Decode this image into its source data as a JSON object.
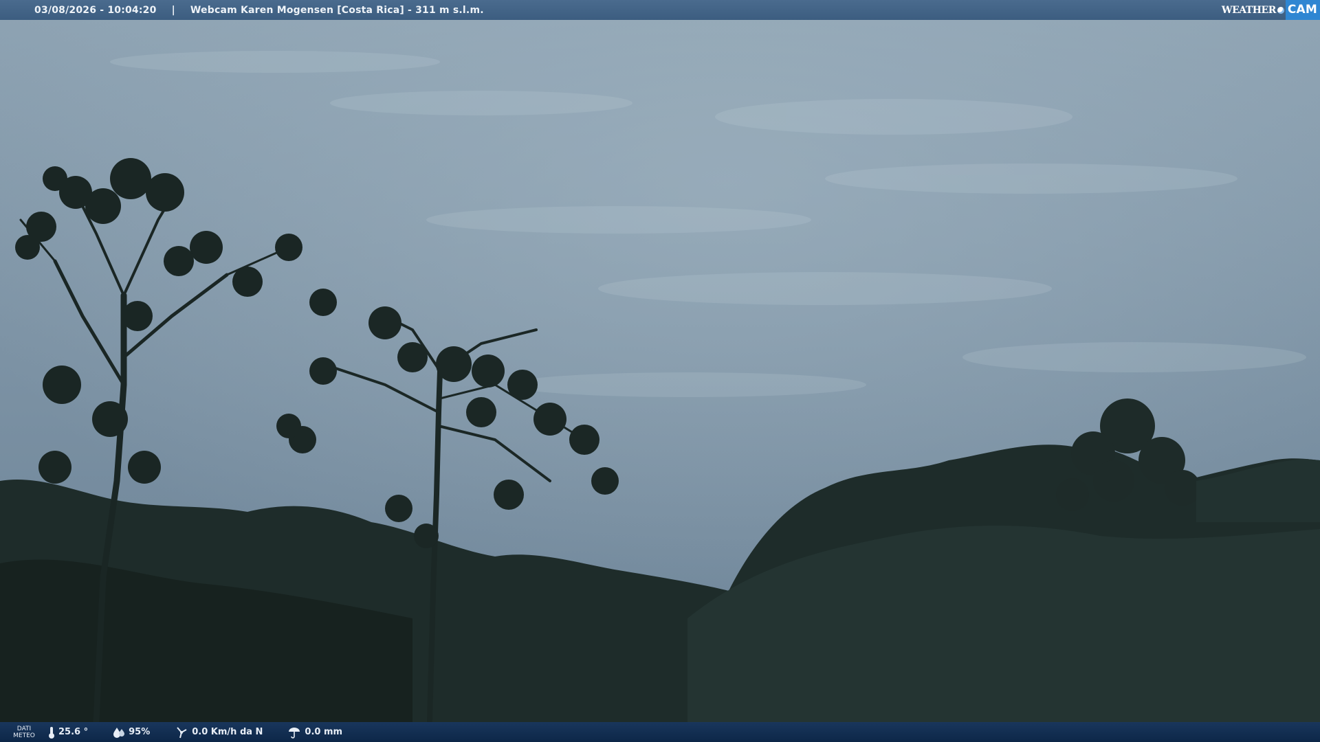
{
  "topbar": {
    "datetime": "03/08/2026 - 10:04:20",
    "separator": "|",
    "title": "Webcam Karen Mogensen [Costa Rica]  - 311 m s.l.m."
  },
  "logo": {
    "weather": "WEATHER",
    "cam": "CAM"
  },
  "bottombar": {
    "dati_line1": "DATI",
    "dati_line2": "METEO",
    "temperature": "25.6 °",
    "humidity": "95%",
    "wind": "0.0 Km/h da N",
    "rain": "0.0 mm"
  },
  "icons": [
    "thermometer-icon",
    "humidity-icon",
    "wind-icon",
    "rain-icon"
  ],
  "colors": {
    "topbar": "#3c5d80",
    "bottombar": "#0d2748",
    "logo_accent": "#2f86d2"
  }
}
